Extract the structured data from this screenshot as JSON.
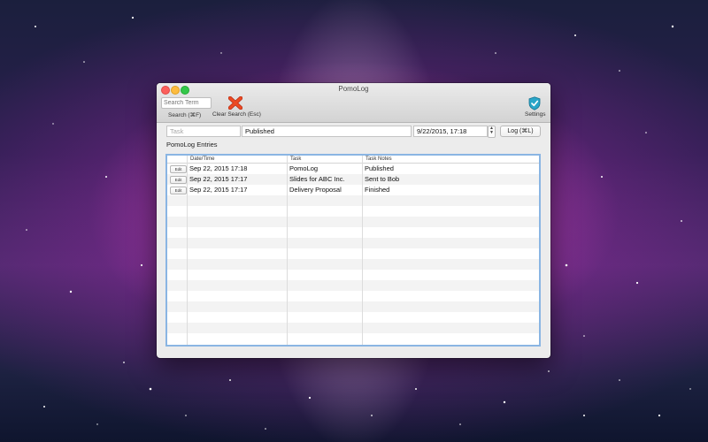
{
  "window": {
    "title": "PomoLog"
  },
  "toolbar": {
    "search_placeholder": "Search Term",
    "search_label": "Search (⌘F)",
    "clear_label": "Clear Search (Esc)",
    "settings_label": "Settings",
    "clear_icon": "red-x-icon",
    "settings_icon": "shield-check-icon"
  },
  "form": {
    "task_placeholder": "Task",
    "notes_value": "Published",
    "datetime_value": "9/22/2015, 17:18",
    "stepper_up": "▲",
    "stepper_down": "▼",
    "log_button": "Log (⌘L)"
  },
  "entries": {
    "label": "PomoLog Entries",
    "columns": [
      "",
      "Date/Time",
      "Task",
      "Task Notes"
    ],
    "edit_label": "Edit",
    "rows": [
      {
        "datetime": "Sep 22, 2015 17:18",
        "task": "PomoLog",
        "notes": "Published"
      },
      {
        "datetime": "Sep 22, 2015 17:17",
        "task": "Slides for ABC Inc.",
        "notes": "Sent to Bob"
      },
      {
        "datetime": "Sep 22, 2015 17:17",
        "task": "Delivery Proposal",
        "notes": "Finished"
      }
    ]
  },
  "colors": {
    "selection_border": "#8ab5e3",
    "close": "#fc605c",
    "minimize": "#fdbc40",
    "zoom": "#34c84a"
  }
}
